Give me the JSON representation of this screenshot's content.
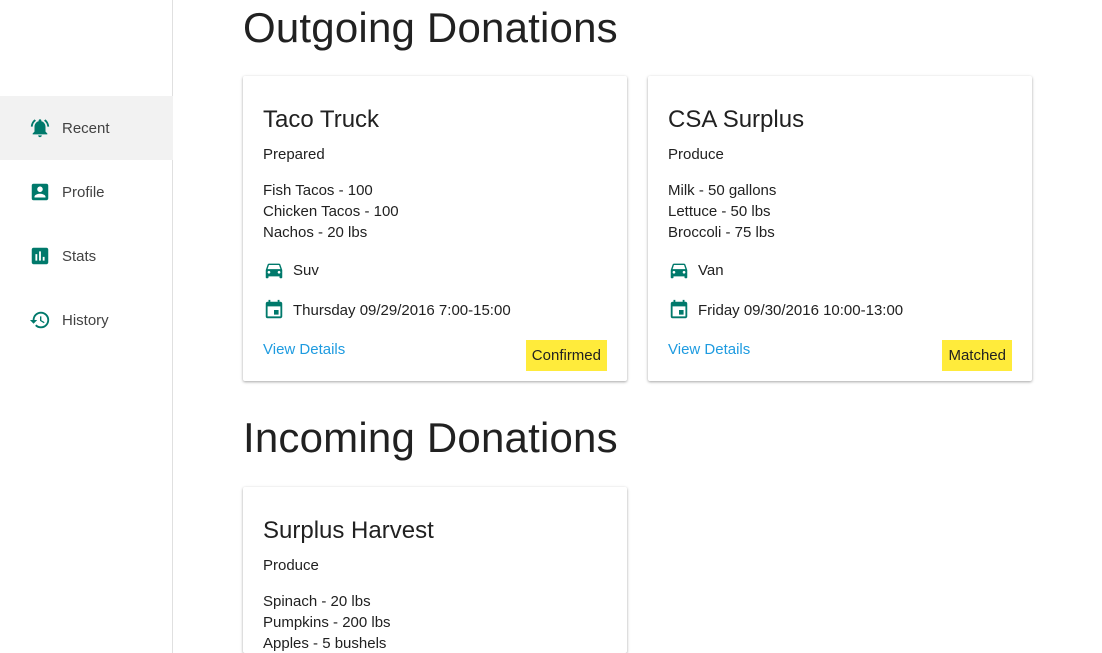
{
  "sidebar": {
    "items": [
      {
        "label": "Recent",
        "icon": "alarm-bell-icon",
        "active": true
      },
      {
        "label": "Profile",
        "icon": "account-box-icon",
        "active": false
      },
      {
        "label": "Stats",
        "icon": "bar-chart-icon",
        "active": false
      },
      {
        "label": "History",
        "icon": "history-icon",
        "active": false
      }
    ]
  },
  "outgoing": {
    "title": "Outgoing Donations",
    "cards": [
      {
        "title": "Taco Truck",
        "category": "Prepared",
        "items": [
          "Fish Tacos - 100",
          "Chicken Tacos - 100",
          "Nachos - 20 lbs"
        ],
        "vehicle": "Suv",
        "schedule": "Thursday 09/29/2016 7:00-15:00",
        "link": "View Details",
        "status": "Confirmed"
      },
      {
        "title": "CSA Surplus",
        "category": "Produce",
        "items": [
          "Milk - 50 gallons",
          "Lettuce - 50 lbs",
          "Broccoli - 75 lbs"
        ],
        "vehicle": "Van",
        "schedule": "Friday 09/30/2016 10:00-13:00",
        "link": "View Details",
        "status": "Matched"
      }
    ]
  },
  "incoming": {
    "title": "Incoming Donations",
    "cards": [
      {
        "title": "Surplus Harvest",
        "category": "Produce",
        "items": [
          "Spinach - 20 lbs",
          "Pumpkins - 200 lbs",
          "Apples - 5 bushels"
        ]
      }
    ]
  },
  "colors": {
    "accent": "#00796b",
    "link": "#1e9be0",
    "badge": "#ffeb3b",
    "active_nav": "#f2f2f2"
  }
}
